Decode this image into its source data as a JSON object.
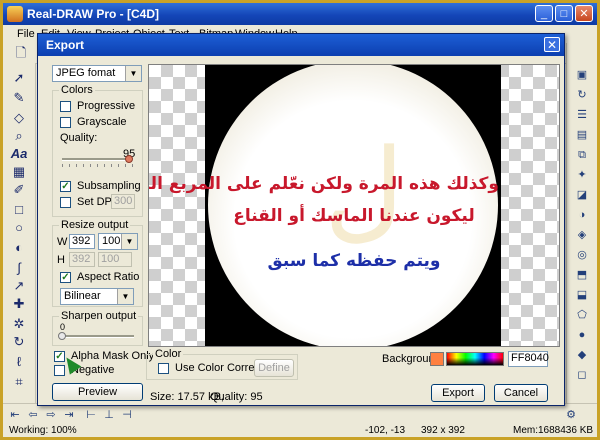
{
  "app": {
    "title": "Real-DRAW Pro - [C4D]",
    "menu": [
      "File",
      "Edit",
      "View",
      "Project",
      "Object",
      "Text",
      "Bitmap",
      "Window",
      "Help"
    ]
  },
  "dialog": {
    "title": "Export",
    "format": "JPEG fomat",
    "colors": {
      "label": "Colors",
      "progressive": {
        "label": "Progressive",
        "checked": false
      },
      "grayscale": {
        "label": "Grayscale",
        "checked": false
      },
      "quality_label": "Quality:",
      "quality_value": "95",
      "subsampling": {
        "label": "Subsampling",
        "checked": true
      },
      "set_dpi": {
        "label": "Set DPI",
        "checked": false,
        "value": "300"
      }
    },
    "resize": {
      "label": "Resize output",
      "w_label": "W",
      "w_value": "392",
      "w_percent": "100",
      "h_label": "H",
      "h_value": "392",
      "h_percent": "100",
      "aspect_ratio": {
        "label": "Aspect Ratio",
        "checked": true
      },
      "method": "Bilinear"
    },
    "sharpen": {
      "label": "Sharpen output",
      "value": "0"
    },
    "alpha_mask": {
      "label": "Alpha Mask Only",
      "checked": true
    },
    "negative": {
      "label": "Negative",
      "checked": false
    },
    "preview_button": "Preview",
    "color": {
      "label": "Color",
      "use_color_correction": {
        "label": "Use Color Correction",
        "checked": false
      },
      "define_button": "Define"
    },
    "background": {
      "label": "Background",
      "value": "FF8040",
      "color": "#ff8040"
    },
    "info": {
      "size": "Size: 17.57 kB,",
      "quality": "Quality: 95"
    },
    "export_button": "Export",
    "cancel_button": "Cancel",
    "image_text": {
      "line1": "وكذلك هذه المرة ولكن نعّلم على المربع التالي",
      "line2": "ليكون عندنا الماسك أو القناع",
      "line3": "ويتم حفظه كما سبق"
    }
  },
  "status": {
    "working": "Working: 100%",
    "coords": "-102, -13",
    "dims": "392 x 392",
    "memory": "Mem:1688436 KB"
  }
}
